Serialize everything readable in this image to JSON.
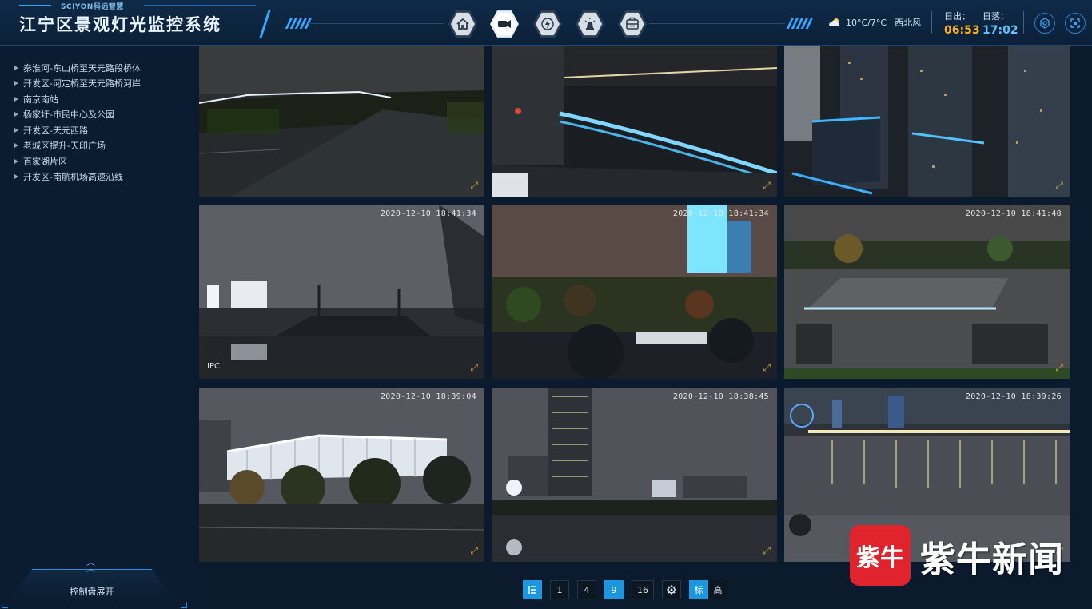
{
  "header": {
    "brand_sub": "SCIYON科远智慧",
    "title": "江宁区景观灯光监控系统",
    "nav": [
      {
        "icon": "home-icon",
        "active": false
      },
      {
        "icon": "camera-icon",
        "active": true
      },
      {
        "icon": "lightning-icon",
        "active": false
      },
      {
        "icon": "lamp-icon",
        "active": false
      },
      {
        "icon": "cabinet-icon",
        "active": false
      }
    ],
    "weather": {
      "icon": "cloudy-icon",
      "temperature": "10°C/7°C",
      "wind": "西北风"
    },
    "sunrise": {
      "label": "日出：",
      "value": "06:53"
    },
    "sunset": {
      "label": "日落：",
      "value": "17:02"
    },
    "actions": [
      "settings-icon",
      "fullscreen-icon"
    ]
  },
  "sidebar": {
    "items": [
      "秦淮河-东山桥至天元路段桥体",
      "开发区-河定桥至天元路桥河岸",
      "南京南站",
      "杨家圩-市民中心及公园",
      "开发区-天元西路",
      "老城区提升-天印广场",
      "百家湖片区",
      "开发区-南航机场高速沿线"
    ],
    "control_panel": "控制盘展开"
  },
  "cameras": [
    {
      "timestamp": "",
      "ipc": "",
      "selected": true
    },
    {
      "timestamp": "",
      "ipc": "",
      "selected": false
    },
    {
      "timestamp": "",
      "ipc": "",
      "selected": false
    },
    {
      "timestamp": "2020-12-10 18:41:34",
      "ipc": "IPC",
      "selected": false
    },
    {
      "timestamp": "2020-12-10 18:41:34",
      "ipc": "",
      "selected": false
    },
    {
      "timestamp": "2020-12-10 18:41:48",
      "ipc": "",
      "selected": false
    },
    {
      "timestamp": "2020-12-10 18:39:04",
      "ipc": "",
      "selected": false
    },
    {
      "timestamp": "2020-12-10 18:38:45",
      "ipc": "",
      "selected": false
    },
    {
      "timestamp": "2020-12-10 18:39:26",
      "ipc": "",
      "selected": false
    }
  ],
  "toolbar": {
    "layouts": [
      "1",
      "4",
      "9",
      "16"
    ],
    "active_layout": "9",
    "quality_sd": "标",
    "quality_hd": "高"
  },
  "watermark": {
    "badge": "紫牛",
    "text": "紫牛新闻"
  },
  "colors": {
    "accent": "#1b97e0",
    "sunrise": "#ffb020",
    "sunset": "#5cc4ff",
    "selection": "#d9a436",
    "watermark_red": "#e0232d"
  }
}
